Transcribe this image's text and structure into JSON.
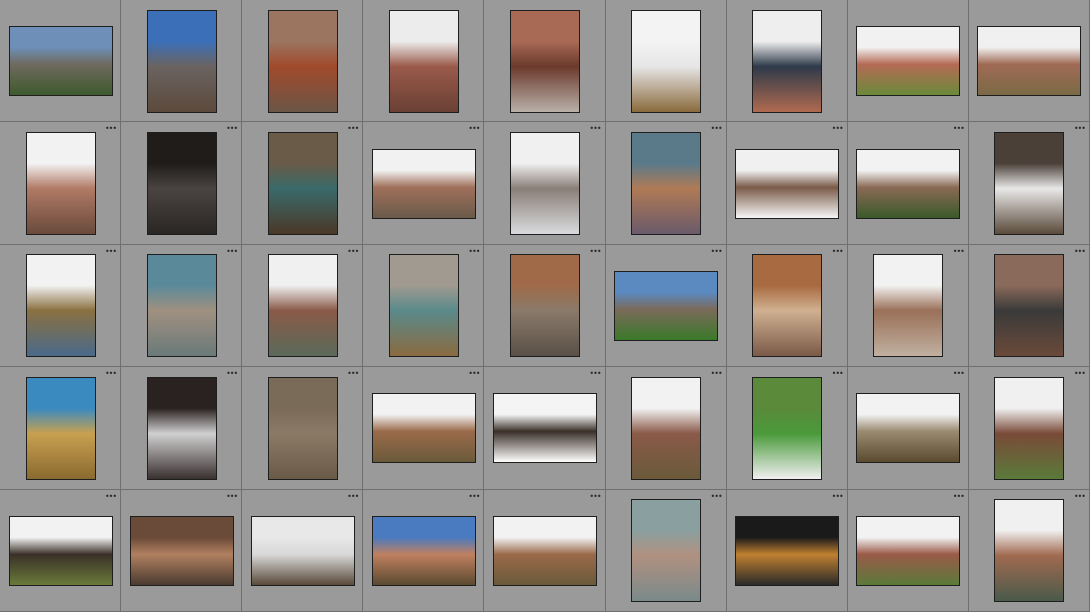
{
  "grid": {
    "rows": 5,
    "cols": 9,
    "options_icon": "more-dots-icon",
    "options_glyph": "•••"
  },
  "thumbnails": [
    {
      "o": "l",
      "c": [
        "#6d8fb8",
        "#6e6a5e",
        "#3f5a2e"
      ]
    },
    {
      "o": "p",
      "c": [
        "#3b6fb8",
        "#6a6360",
        "#5c4a3c"
      ]
    },
    {
      "o": "p",
      "c": [
        "#9b7560",
        "#a14a2c",
        "#6b5645"
      ]
    },
    {
      "o": "p",
      "c": [
        "#ececec",
        "#9a5a4a",
        "#6a4035"
      ]
    },
    {
      "o": "p",
      "c": [
        "#a86a55",
        "#6b3a2c",
        "#b9b0a8"
      ]
    },
    {
      "o": "p",
      "c": [
        "#f3f3f3",
        "#e6e6e6",
        "#8a6a3c"
      ]
    },
    {
      "o": "p",
      "c": [
        "#eeeeee",
        "#2e3a4a",
        "#b06a50"
      ]
    },
    {
      "o": "l",
      "c": [
        "#f1f1f1",
        "#b46a55",
        "#6a8a3a"
      ]
    },
    {
      "o": "l",
      "c": [
        "#f0f0f0",
        "#a06a55",
        "#7a6a45"
      ]
    },
    {
      "o": "p",
      "c": [
        "#f2f2f2",
        "#b07a66",
        "#6a4a3c"
      ]
    },
    {
      "o": "p",
      "c": [
        "#1f1c1a",
        "#4a4442",
        "#2a2624"
      ]
    },
    {
      "o": "p",
      "c": [
        "#6a5a48",
        "#3a6a6a",
        "#4a3828"
      ]
    },
    {
      "o": "l",
      "c": [
        "#f1f1f1",
        "#a0705a",
        "#6a5a4a"
      ]
    },
    {
      "o": "p",
      "c": [
        "#f0f0f0",
        "#8a7f78",
        "#d9dade"
      ]
    },
    {
      "o": "p",
      "c": [
        "#5a7a8a",
        "#b07a55",
        "#6a5a6a"
      ]
    },
    {
      "o": "l",
      "c": [
        "#f0f0f0",
        "#7a5a48",
        "#f6f6f6"
      ]
    },
    {
      "o": "l",
      "c": [
        "#f2f2f2",
        "#8a6a55",
        "#3a5a2a"
      ]
    },
    {
      "o": "p",
      "c": [
        "#4a4038",
        "#e8e8e8",
        "#5a4a3a"
      ]
    },
    {
      "o": "p",
      "c": [
        "#f2f2f2",
        "#8a7040",
        "#4a6a8a"
      ]
    },
    {
      "o": "p",
      "c": [
        "#5a8a9a",
        "#a09080",
        "#6a7a7a"
      ]
    },
    {
      "o": "p",
      "c": [
        "#f0f0f0",
        "#8a5a48",
        "#5a6a5a"
      ]
    },
    {
      "o": "p",
      "c": [
        "#a09a90",
        "#5a8a8a",
        "#8a6a40"
      ]
    },
    {
      "o": "p",
      "c": [
        "#a06a48",
        "#8a7a6a",
        "#5a5048"
      ]
    },
    {
      "o": "l",
      "c": [
        "#5a8ac0",
        "#7a6a5a",
        "#3a7a2a"
      ]
    },
    {
      "o": "p",
      "c": [
        "#a86a40",
        "#d0b090",
        "#7a5a48"
      ]
    },
    {
      "o": "p",
      "c": [
        "#f2f2f2",
        "#9a7058",
        "#c0b0a0"
      ]
    },
    {
      "o": "p",
      "c": [
        "#8a6a5a",
        "#3a3a3a",
        "#6a4a3a"
      ]
    },
    {
      "o": "p",
      "c": [
        "#3a8ac0",
        "#c8a050",
        "#8a6a30"
      ]
    },
    {
      "o": "p",
      "c": [
        "#2a2220",
        "#d0d0d0",
        "#3a3030"
      ]
    },
    {
      "o": "p",
      "c": [
        "#7a6a58",
        "#8a7a66",
        "#6a5a48"
      ]
    },
    {
      "o": "l",
      "c": [
        "#f2f2f2",
        "#9a6a4a",
        "#6a5a3a"
      ]
    },
    {
      "o": "l",
      "c": [
        "#f4f4f4",
        "#3a3028",
        "#ffffff"
      ]
    },
    {
      "o": "p",
      "c": [
        "#f2f2f2",
        "#8a5a48",
        "#6a5a3a"
      ]
    },
    {
      "o": "p",
      "c": [
        "#5a8a3a",
        "#4a9a3a",
        "#f0f0f0"
      ]
    },
    {
      "o": "l",
      "c": [
        "#f2f2f2",
        "#9a8a70",
        "#5a4a30"
      ]
    },
    {
      "o": "p",
      "c": [
        "#f0f0f0",
        "#7a4a38",
        "#5a7a3a"
      ]
    },
    {
      "o": "l",
      "c": [
        "#f2f2f2",
        "#3a3028",
        "#6a7a3a"
      ]
    },
    {
      "o": "l",
      "c": [
        "#6a4a38",
        "#b08060",
        "#4a3a30"
      ]
    },
    {
      "o": "l",
      "c": [
        "#e8e8e8",
        "#d8d8d8",
        "#5a4a3a"
      ]
    },
    {
      "o": "l",
      "c": [
        "#4a7ac0",
        "#c08060",
        "#5a4a30"
      ]
    },
    {
      "o": "l",
      "c": [
        "#f2f2f2",
        "#9a6a4a",
        "#6a5a3a"
      ]
    },
    {
      "o": "p",
      "c": [
        "#8aa0a0",
        "#b09080",
        "#7a8a8a"
      ]
    },
    {
      "o": "l",
      "c": [
        "#1a1a1a",
        "#c08030",
        "#2a2a2a"
      ]
    },
    {
      "o": "l",
      "c": [
        "#f2f2f2",
        "#9a5a48",
        "#5a7a3a"
      ]
    },
    {
      "o": "p",
      "c": [
        "#f0f0f0",
        "#a06a50",
        "#4a5a4a"
      ]
    }
  ]
}
